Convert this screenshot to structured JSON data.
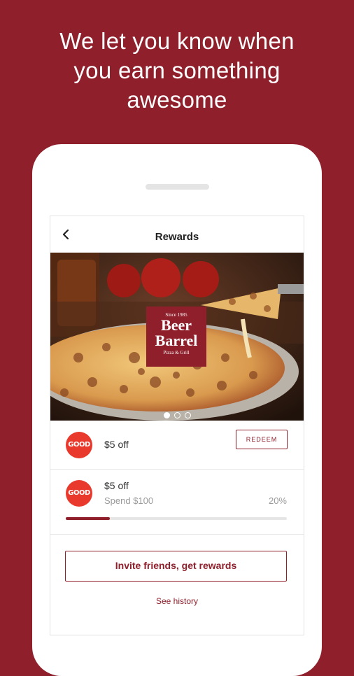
{
  "headline": [
    "We let you know when",
    "you earn something",
    "awesome"
  ],
  "screen": {
    "title": "Rewards",
    "hero": {
      "logo_lines": [
        "Since 1985",
        "Beer",
        "Barrel",
        "Pizza & Grill"
      ],
      "carousel_count": 3,
      "carousel_active": 0
    },
    "rewards": [
      {
        "badge": "GOOD",
        "label": "$5 off",
        "action": "REDEEM"
      },
      {
        "badge": "GOOD",
        "label": "$5 off",
        "sub": "Spend $100",
        "percent": "20%",
        "progress": 0.2
      }
    ],
    "invite_label": "Invite friends, get rewards",
    "history_label": "See history"
  },
  "colors": {
    "brand": "#8f1f2b",
    "badge": "#e8392c"
  },
  "icons": {
    "back": "chevron-left-icon"
  }
}
